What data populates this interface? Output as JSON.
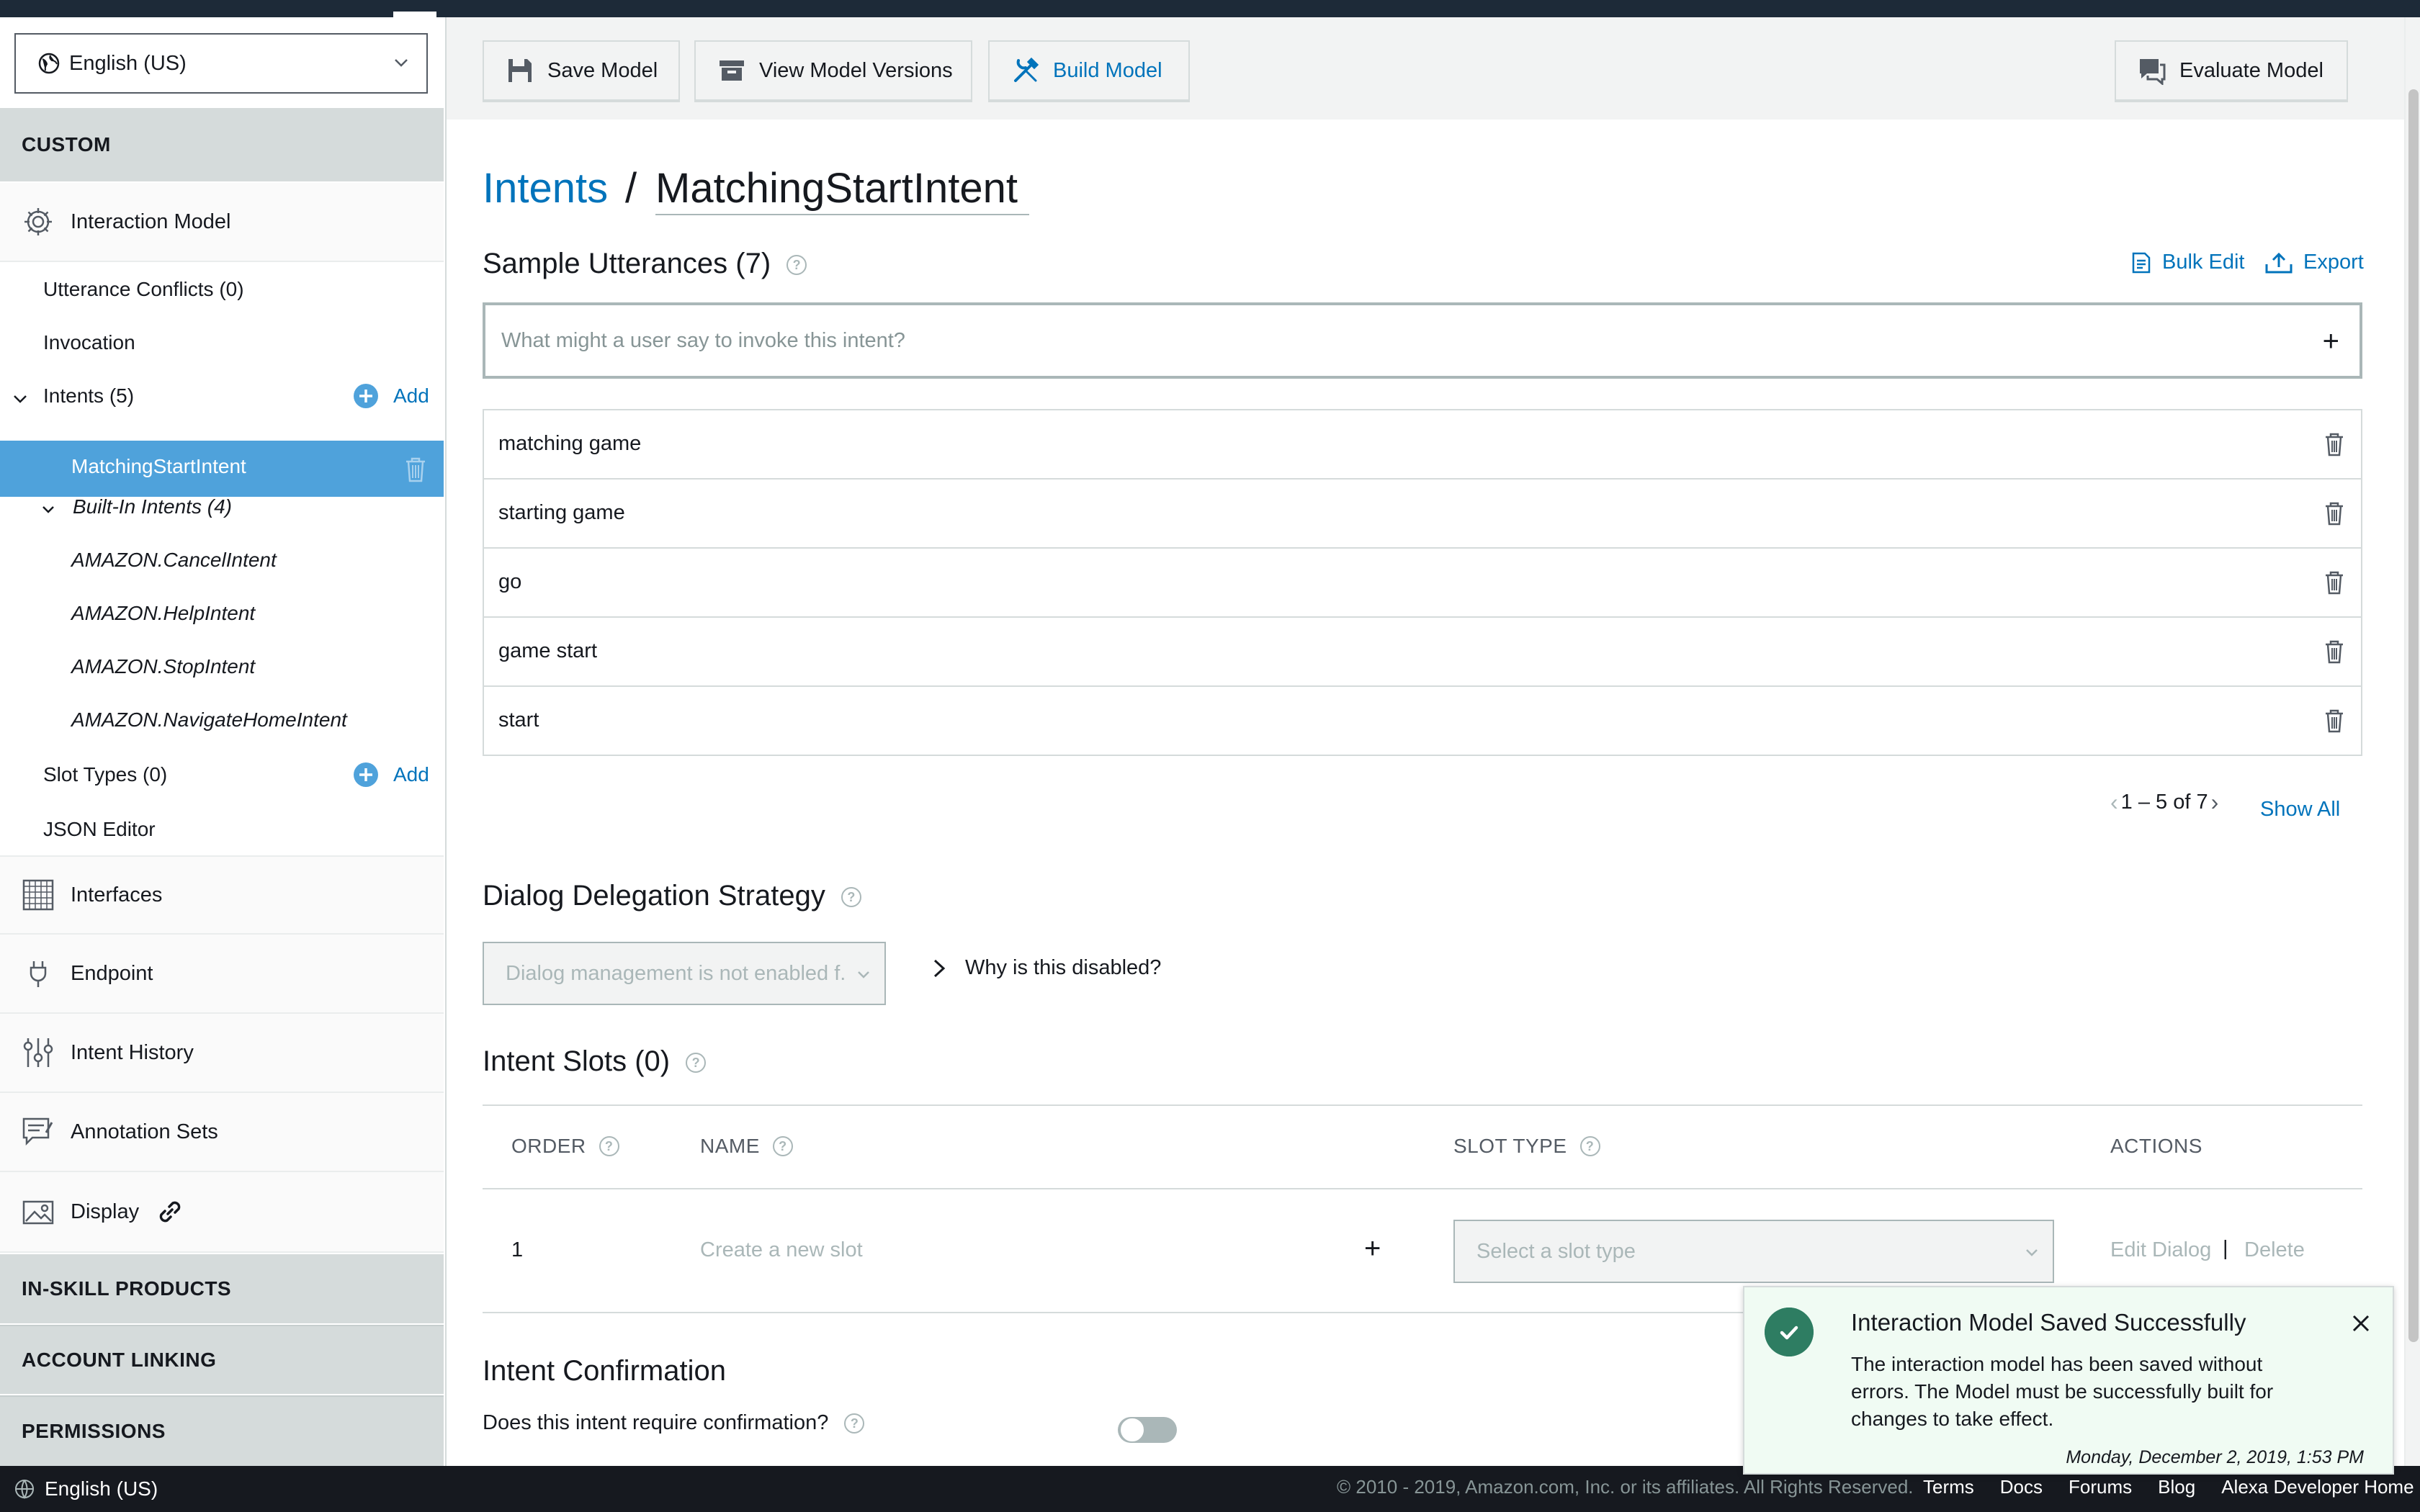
{
  "sidebar": {
    "locale": "English (US)",
    "custom_header": "CUSTOM",
    "interaction_model": "Interaction Model",
    "utterance_conflicts": "Utterance Conflicts (0)",
    "invocation": "Invocation",
    "intents": "Intents (5)",
    "add_label": "Add",
    "selected_intent": "MatchingStartIntent",
    "built_in": "Built-In Intents (4)",
    "built_in_items": [
      "AMAZON.CancelIntent",
      "AMAZON.HelpIntent",
      "AMAZON.StopIntent",
      "AMAZON.NavigateHomeIntent"
    ],
    "slot_types": "Slot Types (0)",
    "json_editor": "JSON Editor",
    "interfaces": "Interfaces",
    "endpoint": "Endpoint",
    "intent_history": "Intent History",
    "annotation_sets": "Annotation Sets",
    "display": "Display",
    "in_skill_products": "IN-SKILL PRODUCTS",
    "account_linking": "ACCOUNT LINKING",
    "permissions": "PERMISSIONS"
  },
  "toolbar": {
    "save": "Save Model",
    "versions": "View Model Versions",
    "build": "Build Model",
    "evaluate": "Evaluate Model"
  },
  "breadcrumb": {
    "parent": "Intents",
    "sep": "/",
    "current": "MatchingStartIntent"
  },
  "utterances": {
    "title": "Sample Utterances (7)",
    "bulk_edit": "Bulk Edit",
    "export": "Export",
    "placeholder": "What might a user say to invoke this intent?",
    "items": [
      "matching game",
      "starting game",
      "go",
      "game start",
      "start"
    ],
    "pager": "1 – 5 of 7",
    "show_all": "Show All"
  },
  "dialog": {
    "title": "Dialog Delegation Strategy",
    "dropdown": "Dialog management is not enabled f...",
    "why": "Why is this disabled?"
  },
  "slots": {
    "title": "Intent Slots (0)",
    "headers": {
      "order": "ORDER",
      "name": "NAME",
      "slot_type": "SLOT TYPE",
      "actions": "ACTIONS"
    },
    "row_order": "1",
    "name_placeholder": "Create a new slot",
    "slot_type_placeholder": "Select a slot type",
    "edit_dialog": "Edit Dialog",
    "action_sep": "|",
    "delete": "Delete"
  },
  "confirmation": {
    "title": "Intent Confirmation",
    "question": "Does this intent require confirmation?",
    "enabled": false
  },
  "toast": {
    "title": "Interaction Model Saved Successfully",
    "message": "The interaction model has been saved without errors. The Model must be successfully built for changes to take effect.",
    "timestamp": "Monday, December 2, 2019, 1:53 PM"
  },
  "footer": {
    "language": "English (US)",
    "copyright": "© 2010 - 2019, Amazon.com, Inc. or its affiliates. All Rights Reserved.",
    "links": [
      "Terms",
      "Docs",
      "Forums",
      "Blog",
      "Alexa Developer Home"
    ]
  },
  "colors": {
    "accent": "#0073bb",
    "selected": "#4fa2db",
    "success": "#2e7d62",
    "section": "#d5dbdb",
    "footer": "#16191f"
  }
}
